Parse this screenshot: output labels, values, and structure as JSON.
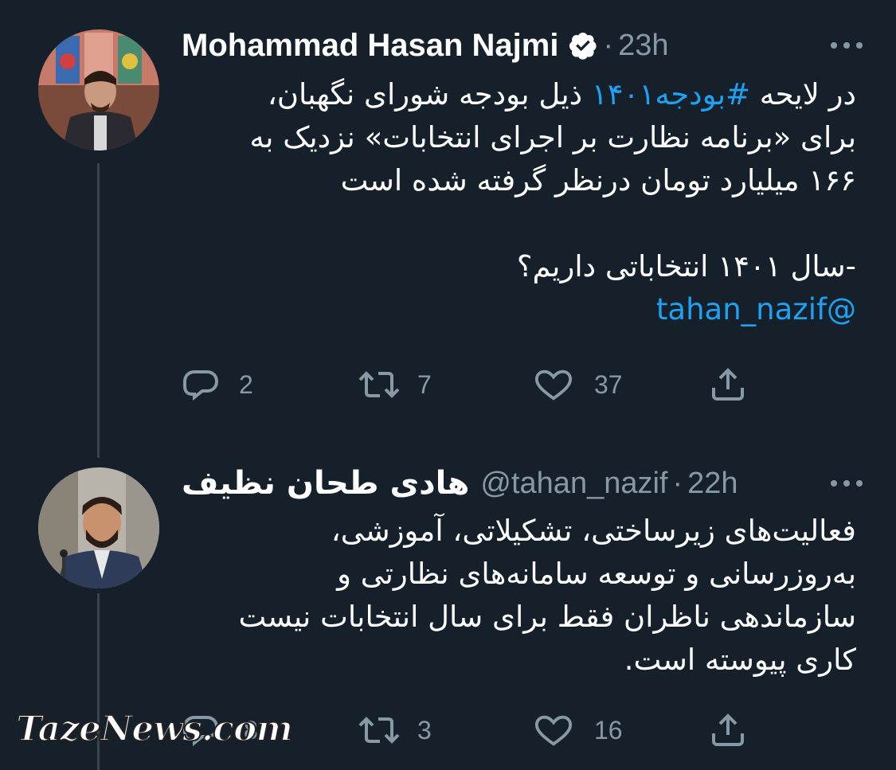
{
  "tweet1": {
    "display_name": "Mohammad Hasan Najmi",
    "verified": true,
    "separator": "·",
    "time": "23h",
    "text_line1_a": "در لایحه ",
    "text_line1_hashtag": "#بودجه۱۴۰۱",
    "text_line1_b": " ذیل بودجه شورای نگهبان،",
    "text_line2": "برای «برنامه نظارت بر اجرای انتخابات» نزدیک به",
    "text_line3": "۱۶۶ میلیارد تومان درنظر گرفته شده است",
    "text_line4": "-سال ۱۴۰۱ انتخاباتی داریم؟",
    "text_mention": "@tahan_nazif",
    "replies": "2",
    "retweets": "7",
    "likes": "37"
  },
  "tweet2": {
    "display_name": "هادی طحان نظیف",
    "handle": "@tahan_nazif",
    "separator": "·",
    "time": "22h",
    "text_line1": "فعالیت‌های زیرساختی، تشکیلاتی، آموزشی،",
    "text_line2": "به‌روزرسانی و توسعه سامانه‌های نظارتی و",
    "text_line3": "سازماندهی ناظران فقط برای سال انتخابات نیست",
    "text_line4": "کاری پیوسته است.",
    "replies": "8",
    "retweets": "3",
    "likes": "16"
  },
  "watermark": "TazeNews.com",
  "colors": {
    "background": "#15202b",
    "text": "#ffffff",
    "secondary": "#8899a6",
    "link": "#1da1f2",
    "thread_line": "#38444d"
  },
  "icons": [
    "verified-badge-icon",
    "more-icon",
    "reply-icon",
    "retweet-icon",
    "like-icon",
    "share-icon"
  ]
}
